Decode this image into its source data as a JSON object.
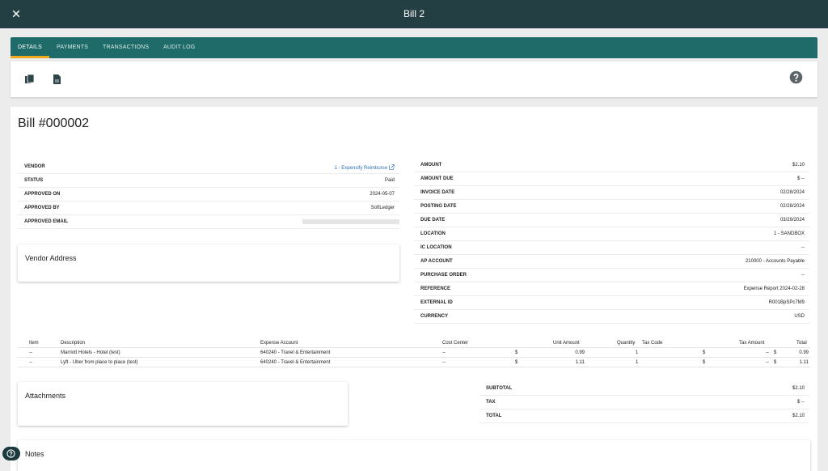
{
  "header": {
    "title": "Bill 2",
    "close_icon": "close-icon"
  },
  "tabs": [
    {
      "label": "DETAILS",
      "active": true
    },
    {
      "label": "PAYMENTS",
      "active": false
    },
    {
      "label": "TRANSACTIONS",
      "active": false
    },
    {
      "label": "AUDIT LOG",
      "active": false
    }
  ],
  "toolbar": {
    "icons": [
      "copy-icon",
      "document-icon"
    ],
    "help_icon": "help-icon"
  },
  "bill": {
    "title": "Bill #000002",
    "left_fields": [
      {
        "label": "VENDOR",
        "value": "1 - Expensify Reimburse",
        "link": true
      },
      {
        "label": "STATUS",
        "value": "Paid"
      },
      {
        "label": "APPROVED ON",
        "value": "2024-05-07"
      },
      {
        "label": "APPROVED BY",
        "value": "SoftLedger"
      },
      {
        "label": "APPROVED EMAIL",
        "value": ""
      }
    ],
    "right_fields": [
      {
        "label": "AMOUNT",
        "value": "$2.10"
      },
      {
        "label": "AMOUNT DUE",
        "value": "$ --"
      },
      {
        "label": "INVOICE DATE",
        "value": "02/28/2024"
      },
      {
        "label": "POSTING DATE",
        "value": "02/28/2024"
      },
      {
        "label": "DUE DATE",
        "value": "03/29/2024"
      },
      {
        "label": "LOCATION",
        "value": "1 - SANDBOX"
      },
      {
        "label": "IC LOCATION",
        "value": "--"
      },
      {
        "label": "AP ACCOUNT",
        "value": "210000 - Accounts Payable"
      },
      {
        "label": "PURCHASE ORDER",
        "value": "--"
      },
      {
        "label": "REFERENCE",
        "value": "Expense Report 2024-02-28"
      },
      {
        "label": "EXTERNAL ID",
        "value": "R001BpSPc7M9"
      },
      {
        "label": "CURRENCY",
        "value": "USD"
      }
    ]
  },
  "panels": {
    "vendor_address": "Vendor Address",
    "attachments": "Attachments",
    "notes": "Notes"
  },
  "line_items": {
    "columns": [
      "Item",
      "Description",
      "Expense Account",
      "Cost Center",
      "Unit Amount",
      "Quantity",
      "Tax Code",
      "Tax Amount",
      "Total"
    ],
    "rows": [
      {
        "item": "--",
        "description": "Marriott Hotels - Hotel (test)",
        "account": "640240 - Travel & Entertainment",
        "cost_center": "--",
        "unit_cur": "$",
        "unit_amount": "0.99",
        "quantity": "1",
        "tax_cur": "$",
        "tax_amount": "--",
        "total_cur": "$",
        "total": "0.99"
      },
      {
        "item": "--",
        "description": "Lyft - Uber from place to place (test)",
        "account": "640240 - Travel & Entertainment",
        "cost_center": "--",
        "unit_cur": "$",
        "unit_amount": "1.11",
        "quantity": "1",
        "tax_cur": "$",
        "tax_amount": "--",
        "total_cur": "$",
        "total": "1.11"
      }
    ]
  },
  "totals": [
    {
      "label": "SUBTOTAL",
      "value": "$2.10"
    },
    {
      "label": "TAX",
      "value": "$ --"
    },
    {
      "label": "TOTAL",
      "value": "$2.10"
    }
  ],
  "colors": {
    "topbar": "#233f44",
    "tabs": "#1f6b69",
    "accent": "#f2a91d",
    "link": "#2d6fb3"
  }
}
